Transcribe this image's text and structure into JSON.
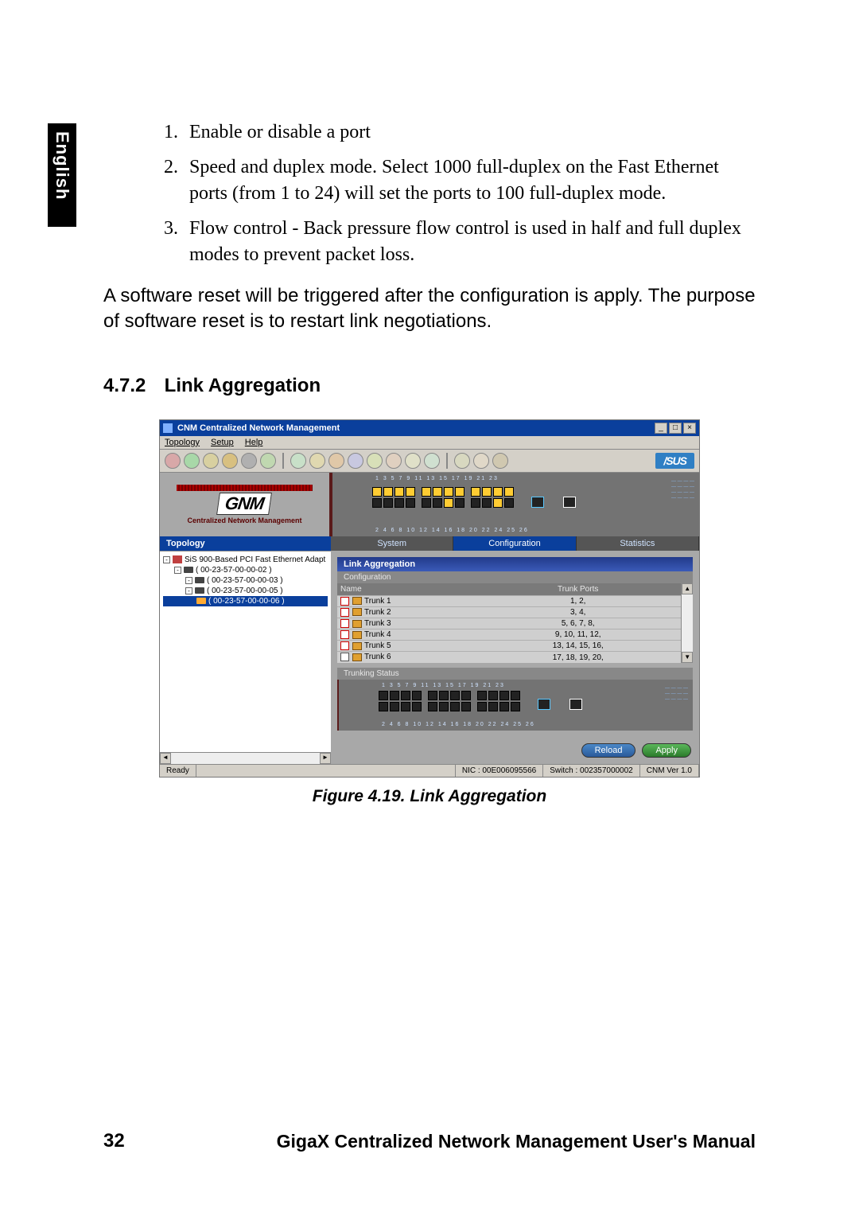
{
  "side_tab": "English",
  "list": {
    "n1": "1.",
    "t1": "Enable or disable a port",
    "n2": "2.",
    "t2": "Speed and duplex mode. Select 1000 full-duplex on the Fast Ethernet ports (from 1 to 24) will set the ports to 100 full-duplex mode.",
    "n3": "3.",
    "t3": "Flow control - Back pressure flow control is used in half and full duplex modes to prevent packet loss."
  },
  "para": "A software reset will be triggered after the configuration is apply. The purpose of software reset is to restart link negotiations.",
  "section": {
    "num": "4.7.2",
    "title": "Link Aggregation"
  },
  "app": {
    "title": "CNM Centralized Network Management",
    "menu": {
      "topology": "Topology",
      "setup": "Setup",
      "help": "Help"
    },
    "brand": "/SUS",
    "logo": "GNM",
    "logo_sub": "Centralized Network Management",
    "topology_header": "Topology",
    "tree": {
      "root": "SiS 900-Based PCI Fast Ethernet Adapt",
      "n1": "( 00-23-57-00-00-02 )",
      "n2": "( 00-23-57-00-00-03 )",
      "n3": "( 00-23-57-00-00-05 )",
      "n4": "( 00-23-57-00-00-06 )"
    },
    "top_ports": "1  3  5  7   9 11 13 15  17 19 21 23",
    "bot_ports": "2  4  6  8  10 12 14 16  18 20 22 24    25          26",
    "tabs": {
      "system": "System",
      "config": "Configuration",
      "stats": "Statistics"
    },
    "panel": {
      "header": "Link Aggregation",
      "sub": "Configuration",
      "col_name": "Name",
      "col_ports": "Trunk Ports",
      "rows": [
        {
          "name": "Trunk 1",
          "ports": "1, 2,"
        },
        {
          "name": "Trunk 2",
          "ports": "3, 4,"
        },
        {
          "name": "Trunk 3",
          "ports": "5, 6, 7, 8,"
        },
        {
          "name": "Trunk 4",
          "ports": "9, 10, 11, 12,"
        },
        {
          "name": "Trunk 5",
          "ports": "13, 14, 15, 16,"
        },
        {
          "name": "Trunk 6",
          "ports": "17, 18, 19, 20,"
        }
      ],
      "status_header": "Trunking Status",
      "status_top": "1  3  5  7   9 11 13 15  17 19 21 23",
      "status_bot": "2   4   6   8   10 12 14 16   18 20 22 24    25            26"
    },
    "buttons": {
      "reload": "Reload",
      "apply": "Apply"
    },
    "statusbar": {
      "ready": "Ready",
      "nic": "NIC : 00E006095566",
      "switch": "Switch : 002357000002",
      "ver": "CNM Ver 1.0"
    },
    "winbtn": {
      "min": "_",
      "max": "□",
      "close": "×"
    },
    "arrows": {
      "left": "◄",
      "right": "►",
      "up": "▲",
      "down": "▼"
    }
  },
  "caption": "Figure 4.19. Link Aggregation",
  "footer": {
    "page": "32",
    "title": "GigaX Centralized Network Management User's Manual"
  }
}
